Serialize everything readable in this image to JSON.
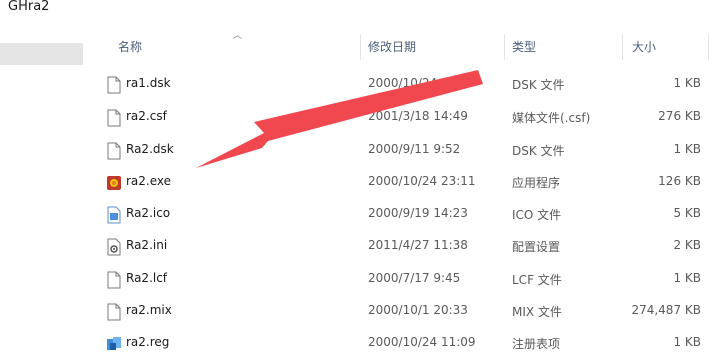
{
  "window": {
    "title": "GHra2"
  },
  "columns": {
    "name": "名称",
    "date": "修改日期",
    "type": "类型",
    "size": "大小"
  },
  "files": [
    {
      "name": "ra1.dsk",
      "date": "2000/10/24 15:29",
      "type": "DSK 文件",
      "size": "1 KB",
      "icon": "blank-file-icon"
    },
    {
      "name": "ra2.csf",
      "date": "2001/3/18 14:49",
      "type": "媒体文件(.csf)",
      "size": "276 KB",
      "icon": "blank-file-icon"
    },
    {
      "name": "Ra2.dsk",
      "date": "2000/9/11 9:52",
      "type": "DSK 文件",
      "size": "1 KB",
      "icon": "blank-file-icon"
    },
    {
      "name": "ra2.exe",
      "date": "2000/10/24 23:11",
      "type": "应用程序",
      "size": "126 KB",
      "icon": "application-icon"
    },
    {
      "name": "Ra2.ico",
      "date": "2000/9/19 14:23",
      "type": "ICO 文件",
      "size": "5 KB",
      "icon": "image-file-icon"
    },
    {
      "name": "Ra2.ini",
      "date": "2011/4/27 11:38",
      "type": "配置设置",
      "size": "2 KB",
      "icon": "settings-file-icon"
    },
    {
      "name": "Ra2.lcf",
      "date": "2000/7/17 9:45",
      "type": "LCF 文件",
      "size": "1 KB",
      "icon": "blank-file-icon"
    },
    {
      "name": "ra2.mix",
      "date": "2000/10/1 20:33",
      "type": "MIX 文件",
      "size": "274,487 KB",
      "icon": "blank-file-icon"
    },
    {
      "name": "ra2.reg",
      "date": "2000/10/24 11:09",
      "type": "注册表项",
      "size": "1 KB",
      "icon": "registry-file-icon"
    }
  ],
  "annotation": {
    "color": "#f0484e"
  }
}
